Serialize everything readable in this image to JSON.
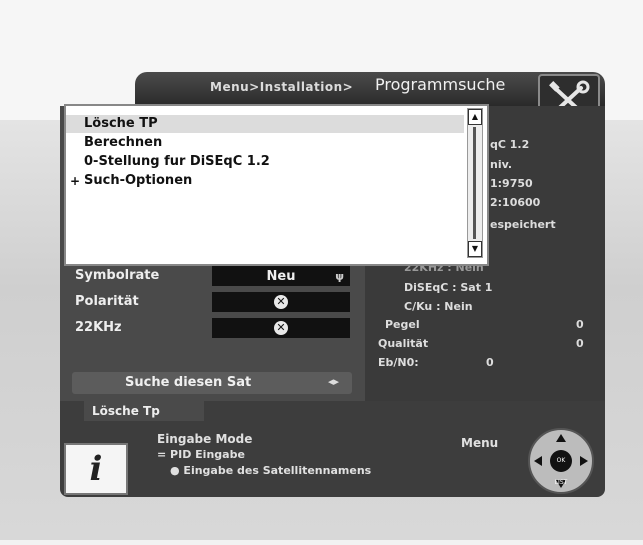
{
  "header": {
    "breadcrumb": "Menu>Installation>",
    "title": "Programmsuche",
    "icon": "tools-icon"
  },
  "popup": {
    "items": [
      {
        "label": "Lösche TP",
        "selected": true
      },
      {
        "label": "Berechnen"
      },
      {
        "label": "0-Stellung fur DiSEqC 1.2"
      },
      {
        "label": "Such-Optionen",
        "marker": "+"
      }
    ]
  },
  "settings": [
    {
      "label": "Symbolrate",
      "value": "Neu",
      "icon": "antenna-icon"
    },
    {
      "label": "Polarität",
      "icon": "x-circle-icon"
    },
    {
      "label": "22KHz",
      "icon": "x-circle-icon"
    }
  ],
  "search": {
    "label": "Suche diesen Sat",
    "icon": "left-right-arrows-icon"
  },
  "info": {
    "lines_top": [
      "qC 1.2",
      "niv.",
      "1:9750",
      "2:10600",
      "espeichert"
    ],
    "lnb_partial": "22KHz : Nein",
    "diseqc": "DiSEqC : Sat 1",
    "cku": "C/Ku : Nein",
    "pegel_label": "Pegel",
    "pegel_value": "0",
    "qualitaet_label": "Qualität",
    "qualitaet_value": "0",
    "ebno_label": "Eb/N0:",
    "ebno_value": "0"
  },
  "help": {
    "title": "Lösche Tp",
    "line1": "Eingabe Mode",
    "line2": "= PID Eingabe",
    "line3": "● Eingabe des Satellitennamens",
    "menu_label": "Menu",
    "remote_center": "OK LIST"
  }
}
